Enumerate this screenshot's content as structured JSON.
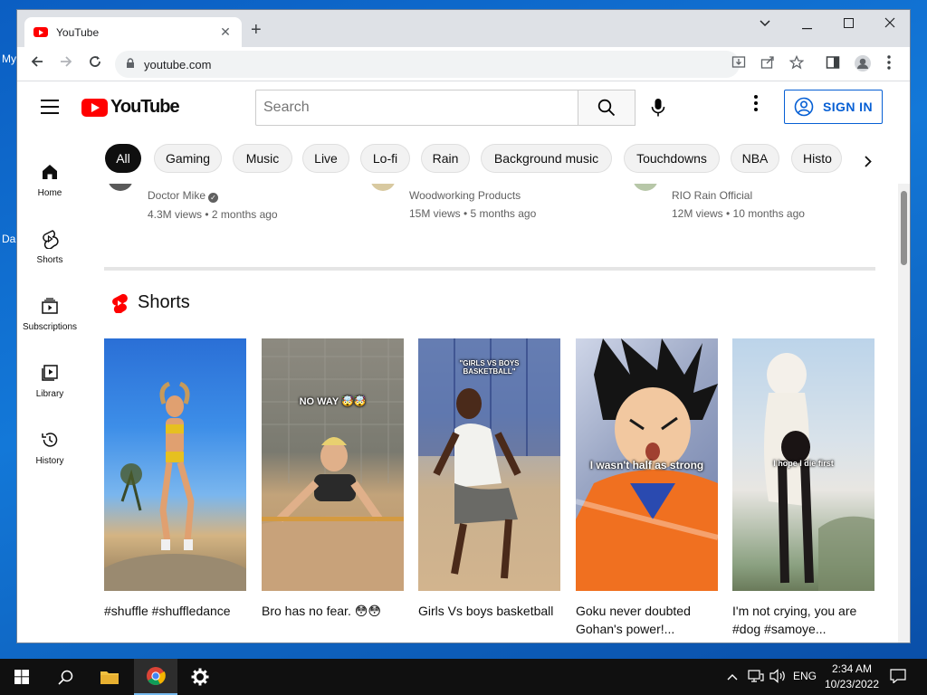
{
  "desktop": {
    "left_labels": [
      "My",
      "Da"
    ]
  },
  "browser": {
    "tab_title": "YouTube",
    "tab_close": "✕",
    "new_tab": "+",
    "window_controls": {
      "dropdown": "⌄",
      "minimize": "—",
      "maximize": "☐",
      "close": "✕"
    },
    "url": "youtube.com"
  },
  "youtube": {
    "logo_text": "YouTube",
    "search_placeholder": "Search",
    "sign_in_label": "SIGN IN",
    "chips": [
      "All",
      "Gaming",
      "Music",
      "Live",
      "Lo-fi",
      "Rain",
      "Background music",
      "Touchdowns",
      "NBA",
      "Histo"
    ],
    "active_chip": "All",
    "guide": [
      {
        "label": "Home",
        "icon": "home-icon"
      },
      {
        "label": "Shorts",
        "icon": "shorts-icon"
      },
      {
        "label": "Subscriptions",
        "icon": "subscriptions-icon"
      },
      {
        "label": "Library",
        "icon": "library-icon"
      },
      {
        "label": "History",
        "icon": "history-icon"
      }
    ],
    "partial_videos": [
      {
        "channel": "Doctor Mike",
        "verified": true,
        "stats": "4.3M views • 2 months ago"
      },
      {
        "channel": "Woodworking Products",
        "verified": false,
        "stats": "15M views • 5 months ago"
      },
      {
        "channel": "RIO Rain Official",
        "verified": false,
        "stats": "12M views • 10 months ago"
      }
    ],
    "shorts_heading": "Shorts",
    "shorts": [
      {
        "caption": "#shuffle #shuffledance",
        "overlay": ""
      },
      {
        "caption": "Bro has no fear. 😳😳",
        "overlay": "NO WAY 🤯🤯"
      },
      {
        "caption": "Girls Vs boys basketball",
        "overlay": "\"GIRLS VS BOYS BASKETBALL\""
      },
      {
        "caption": "Goku never doubted Gohan's power!...",
        "overlay": "I wasn't half as strong"
      },
      {
        "caption": "I'm not crying, you are #dog #samoye...",
        "overlay": "I hope I die first"
      }
    ]
  },
  "taskbar": {
    "language": "ENG",
    "time": "2:34 AM",
    "date": "10/23/2022"
  }
}
